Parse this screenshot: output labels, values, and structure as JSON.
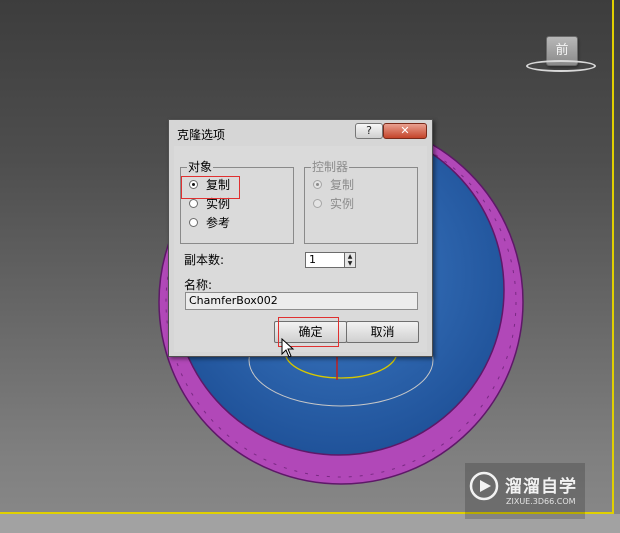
{
  "viewport": {
    "viewcube_label": "前",
    "accent_border_color": "#e0d000"
  },
  "dialog": {
    "title": "克隆选项",
    "help_glyph": "?",
    "close_glyph": "✕",
    "object_group": {
      "legend": "对象",
      "options": [
        {
          "label": "复制",
          "checked": true
        },
        {
          "label": "实例",
          "checked": false
        },
        {
          "label": "参考",
          "checked": false
        }
      ]
    },
    "controller_group": {
      "legend": "控制器",
      "enabled": false,
      "options": [
        {
          "label": "复制",
          "checked": true
        },
        {
          "label": "实例",
          "checked": false
        }
      ]
    },
    "copies_label": "副本数:",
    "copies_value": "1",
    "name_label": "名称:",
    "name_value": "ChamferBox002",
    "ok_label": "确定",
    "cancel_label": "取消",
    "highlight_color": "#e03030"
  },
  "watermark": {
    "title": "溜溜自学",
    "subtitle": "ZIXUE.3D66.COM"
  }
}
